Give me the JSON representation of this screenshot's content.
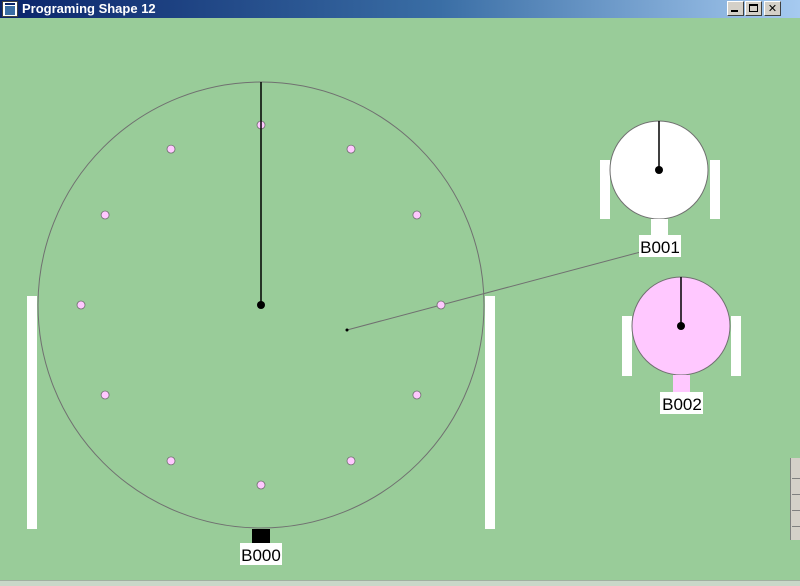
{
  "window": {
    "title": "Programing Shape 12",
    "buttons": {
      "minimize": "_",
      "maximize": "□",
      "close": "✕"
    }
  },
  "canvas": {
    "background": "#99cc99",
    "large_dial": {
      "label": "B000",
      "face_color": "#99cc99",
      "outline_color": "#707070",
      "marker_color": "#ffc8ff",
      "bar_color": "#ffffff"
    },
    "small_dial_1": {
      "label": "B001",
      "face_color": "#ffffff"
    },
    "small_dial_2": {
      "label": "B002",
      "face_color": "#ffc8ff"
    },
    "connector_color": "#707070",
    "hand_color": "#000000"
  }
}
